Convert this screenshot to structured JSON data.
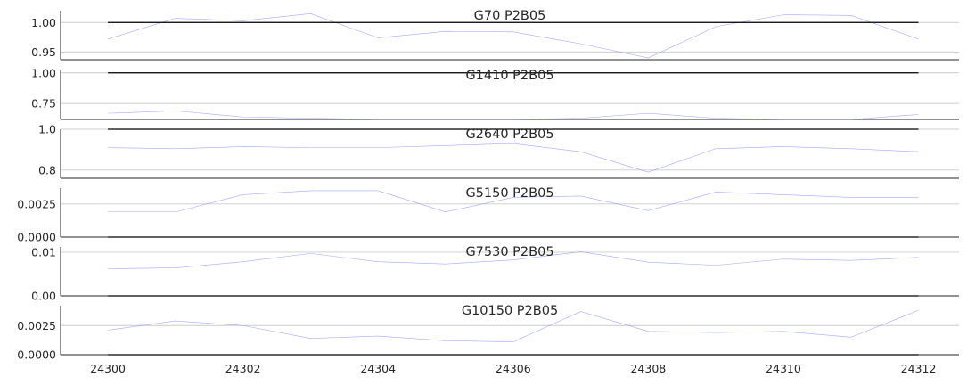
{
  "chart_data": {
    "type": "line",
    "x": [
      24300,
      24301,
      24302,
      24303,
      24304,
      24305,
      24306,
      24307,
      24308,
      24309,
      24310,
      24311,
      24312
    ],
    "x_ticks": [
      "24300",
      "24302",
      "24304",
      "24306",
      "24308",
      "24310",
      "24312"
    ],
    "x_tick_values": [
      24300,
      24302,
      24304,
      24306,
      24308,
      24310,
      24312
    ],
    "xlim": [
      24299.3,
      24312.6
    ],
    "grid": "horizontal",
    "colors": {
      "ref_line": "#000000",
      "series_line": "#8888ff",
      "grid": "#cccccc",
      "axis": "#262626"
    },
    "panels": [
      {
        "title": "G70 P2B05",
        "ylim": [
          0.937,
          1.02
        ],
        "y_ticks": [
          "0.95",
          "1.00"
        ],
        "y_tick_values": [
          0.95,
          1.0
        ],
        "reference": 1.0,
        "values": [
          0.972,
          1.007,
          1.003,
          1.015,
          0.974,
          0.985,
          0.984,
          0.964,
          0.94,
          0.993,
          1.013,
          1.012,
          0.972
        ]
      },
      {
        "title": "G1410 P2B05",
        "ylim": [
          0.62,
          1.02
        ],
        "y_ticks": [
          "0.75",
          "1.00"
        ],
        "y_tick_values": [
          0.75,
          1.0
        ],
        "reference": 1.0,
        "values": [
          0.67,
          0.69,
          0.64,
          0.63,
          0.62,
          0.62,
          0.62,
          0.63,
          0.67,
          0.63,
          0.62,
          0.62,
          0.66
        ]
      },
      {
        "title": "G2640 P2B05",
        "ylim": [
          0.76,
          1.0
        ],
        "y_ticks": [
          "0.8",
          "1.0"
        ],
        "y_tick_values": [
          0.8,
          1.0
        ],
        "reference": 1.0,
        "values": [
          0.91,
          0.905,
          0.915,
          0.91,
          0.91,
          0.92,
          0.93,
          0.89,
          0.79,
          0.905,
          0.915,
          0.905,
          0.89
        ]
      },
      {
        "title": "G5150 P2B05",
        "ylim": [
          0.0,
          0.0037
        ],
        "y_ticks": [
          "0.0000",
          "0.0025"
        ],
        "y_tick_values": [
          0.0,
          0.0025
        ],
        "reference": 0.0,
        "values": [
          0.0019,
          0.0019,
          0.0032,
          0.0035,
          0.0035,
          0.0019,
          0.003,
          0.0031,
          0.002,
          0.0034,
          0.0032,
          0.003,
          0.003
        ]
      },
      {
        "title": "G7530 P2B05",
        "ylim": [
          0.0,
          0.0112
        ],
        "y_ticks": [
          "0.00",
          "0.01"
        ],
        "y_tick_values": [
          0.0,
          0.01
        ],
        "reference": 0.0,
        "values": [
          0.0062,
          0.0064,
          0.0078,
          0.0097,
          0.0078,
          0.0073,
          0.0082,
          0.0101,
          0.0077,
          0.007,
          0.0084,
          0.0081,
          0.0088
        ]
      },
      {
        "title": "G10150 P2B05",
        "ylim": [
          0.0,
          0.0042
        ],
        "y_ticks": [
          "0.0000",
          "0.0025"
        ],
        "y_tick_values": [
          0.0,
          0.0025
        ],
        "reference": 0.0,
        "values": [
          0.0021,
          0.0029,
          0.0025,
          0.0014,
          0.0016,
          0.0012,
          0.0011,
          0.0037,
          0.002,
          0.0019,
          0.002,
          0.0015,
          0.0038
        ]
      }
    ]
  }
}
